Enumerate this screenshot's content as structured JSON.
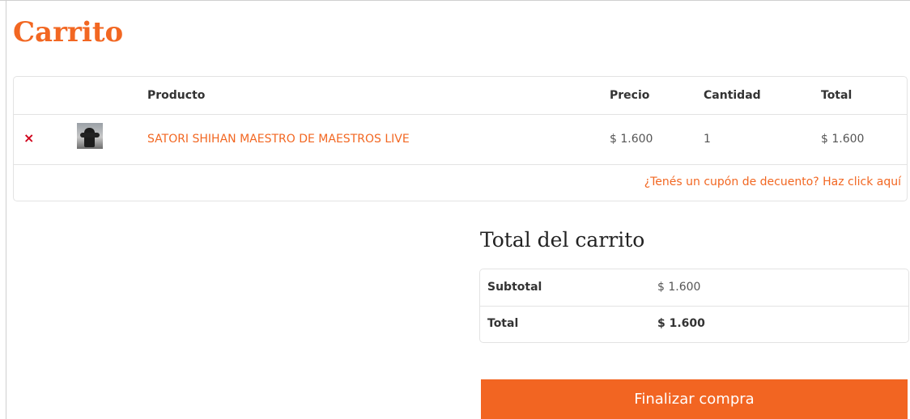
{
  "page": {
    "title": "Carrito"
  },
  "cart_table": {
    "headers": {
      "product": "Producto",
      "price": "Precio",
      "quantity": "Cantidad",
      "total": "Total"
    },
    "items": [
      {
        "remove_icon": "×",
        "thumbnail": "product-thumbnail",
        "product": "SATORI SHIHAN MAESTRO DE MAESTROS LIVE",
        "price": "$ 1.600",
        "quantity": "1",
        "total": "$ 1.600"
      }
    ],
    "coupon_link": "¿Tenés un cupón de decuento? Haz click aquí"
  },
  "cart_totals": {
    "heading": "Total del carrito",
    "subtotal_label": "Subtotal",
    "subtotal_value": "$ 1.600",
    "total_label": "Total",
    "total_value": "$ 1.600"
  },
  "checkout_button": "Finalizar compra",
  "colors": {
    "accent": "#f26722",
    "remove": "#d0021b",
    "border": "#e3e3e3"
  }
}
